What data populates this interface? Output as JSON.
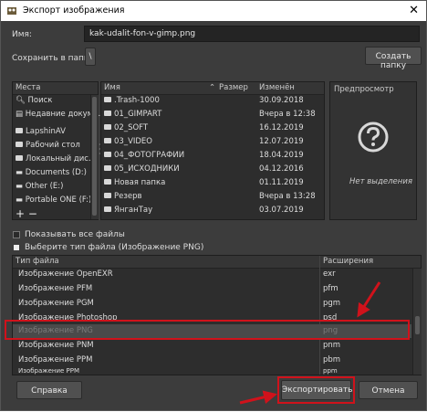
{
  "title": "Экспорт изображения",
  "name_label": "Имя:",
  "filename": "kak-udalit-fon-v-gimp.png",
  "save_in_label": "Сохранить в папке",
  "create_folder": "Создать папку",
  "places": {
    "header": "Места",
    "items": [
      "Поиск",
      "Недавние докум...",
      "LapshinAV",
      "Рабочий стол",
      "Локальный дис...",
      "Documents (D:)",
      "Other (E:)",
      "Portable ONE (F:)"
    ]
  },
  "files": {
    "col_name": "Имя",
    "col_size": "Размер",
    "col_modified": "Изменён",
    "rows": [
      {
        "name": ".Trash-1000",
        "date": "30.09.2018"
      },
      {
        "name": "01_GIMPART",
        "date": "Вчера в 12:38"
      },
      {
        "name": "02_SOFT",
        "date": "16.12.2019"
      },
      {
        "name": "03_VIDEO",
        "date": "12.07.2019"
      },
      {
        "name": "04_ФОТОГРАФИИ",
        "date": "18.04.2019"
      },
      {
        "name": "05_ИСХОДНИКИ",
        "date": "04.12.2016"
      },
      {
        "name": "Новая папка",
        "date": "01.11.2019"
      },
      {
        "name": "Резерв",
        "date": "Вчера в 13:28"
      },
      {
        "name": "ЯнганТау",
        "date": "03.07.2019"
      }
    ]
  },
  "preview": {
    "header": "Предпросмотр",
    "no_selection": "Нет выделения"
  },
  "show_all_files": "Показывать все файлы",
  "select_type": "Выберите тип файла (Изображение PNG)",
  "types": {
    "col_type": "Тип файла",
    "col_ext": "Расширения",
    "rows": [
      {
        "type": "Изображение OpenEXR",
        "ext": "exr"
      },
      {
        "type": "Изображение PFM",
        "ext": "pfm"
      },
      {
        "type": "Изображение PGM",
        "ext": "pgm"
      },
      {
        "type": "Изображение Photoshop",
        "ext": "psd"
      },
      {
        "type": "Изображение PNG",
        "ext": "png"
      },
      {
        "type": "Изображение PNM",
        "ext": "pnm"
      },
      {
        "type": "Изображение PPM",
        "ext": "pbm"
      },
      {
        "type": "Изображение PPM",
        "ext": "ppm"
      }
    ]
  },
  "help": "Справка",
  "export": "Экспортировать",
  "cancel": "Отмена",
  "colors": {
    "highlight": "#d0121b",
    "background": "#3c3c3c"
  }
}
